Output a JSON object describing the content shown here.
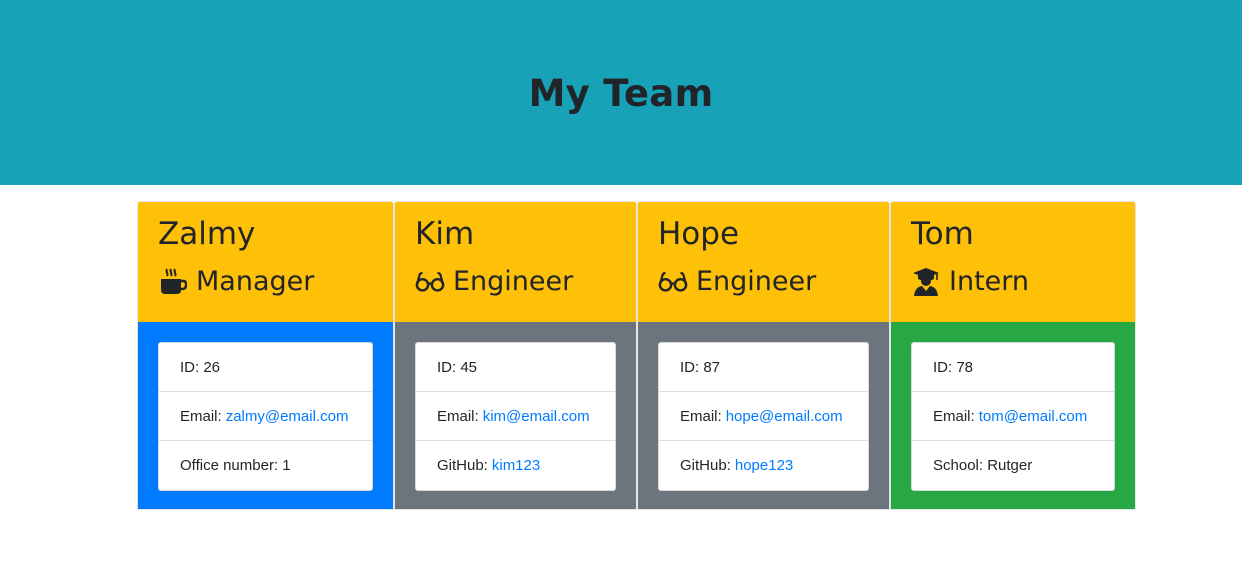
{
  "header": {
    "title": "My Team"
  },
  "colors": {
    "header_bg": "#17a2b8",
    "card_header_bg": "#ffc107",
    "manager": "#007bff",
    "engineer": "#6c757d",
    "intern": "#28a745",
    "link": "#007bff"
  },
  "members": [
    {
      "name": "Zalmy",
      "role": "Manager",
      "role_icon": "mug-icon",
      "id_label": "ID: 26",
      "email_prefix": "Email:",
      "email": "zalmy@email.com",
      "extra_prefix": "Office number: 1",
      "extra_value": ""
    },
    {
      "name": "Kim",
      "role": "Engineer",
      "role_icon": "glasses-icon",
      "id_label": "ID: 45",
      "email_prefix": "Email:",
      "email": "kim@email.com",
      "extra_prefix": "GitHub:",
      "extra_value": "kim123"
    },
    {
      "name": "Hope",
      "role": "Engineer",
      "role_icon": "glasses-icon",
      "id_label": "ID: 87",
      "email_prefix": "Email:",
      "email": "hope@email.com",
      "extra_prefix": "GitHub:",
      "extra_value": "hope123"
    },
    {
      "name": "Tom",
      "role": "Intern",
      "role_icon": "graduate-icon",
      "id_label": "ID: 78",
      "email_prefix": "Email:",
      "email": "tom@email.com",
      "extra_prefix": "School: Rutger",
      "extra_value": ""
    }
  ]
}
